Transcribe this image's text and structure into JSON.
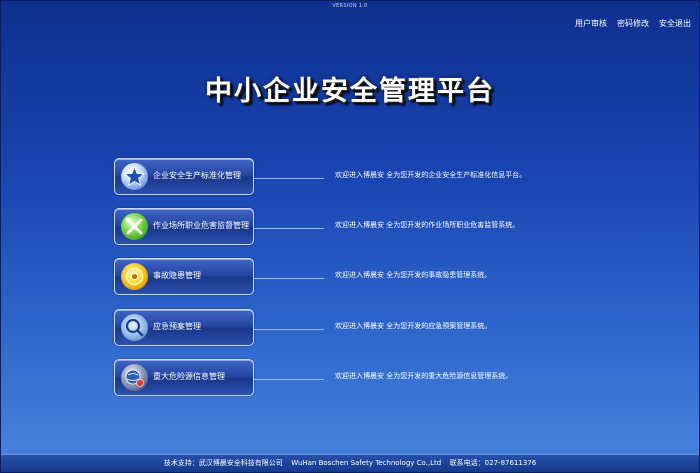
{
  "header": {
    "version": "VERSION 1.0",
    "links": [
      "用户审核",
      "密码修改",
      "安全退出"
    ]
  },
  "title": "中小企业安全管理平台",
  "menu": [
    {
      "label": "企业安全生产标准化管理",
      "desc": "欢迎进入博晨安 全为您开发的企业安全生产标准化信息平台。",
      "icon": "star-icon"
    },
    {
      "label": "作业场所职业危害监督管理",
      "desc": "欢迎进入博晨安 全为您开发的作业场所职业危害监管系统。",
      "icon": "tools-icon"
    },
    {
      "label": "事故隐患管理",
      "desc": "欢迎进入博晨安 全为您开发的事故隐患管理系统。",
      "icon": "disc-icon"
    },
    {
      "label": "应急预案管理",
      "desc": "欢迎进入博晨安 全为您开发的应急预案管理系统。",
      "icon": "magnifier-icon"
    },
    {
      "label": "重大危险源信息管理",
      "desc": "欢迎进入博晨安 全为您开发的重大危险源信息管理系统。",
      "icon": "globe-icon"
    }
  ],
  "footer": {
    "support": "技术支持：武汉博晨安全科技有限公司",
    "company_en": "WuHan Boschen Safety Technology Co.,Ltd",
    "phone": "联系电话：027-87611376"
  }
}
